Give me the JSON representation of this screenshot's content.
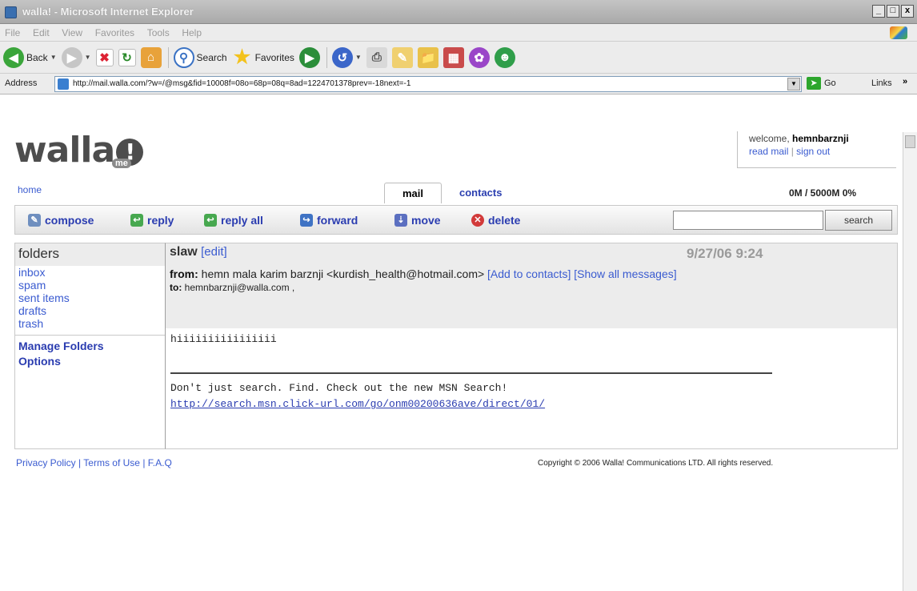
{
  "window": {
    "title": "walla! - Microsoft Internet Explorer",
    "min": "_",
    "max": "□",
    "close": "x"
  },
  "menu": [
    "File",
    "Edit",
    "View",
    "Favorites",
    "Tools",
    "Help"
  ],
  "toolbar": {
    "back": "Back",
    "search": "Search",
    "favorites": "Favorites"
  },
  "address": {
    "label": "Address",
    "url": "http://mail.walla.com/?w=/@msg&fid=10008f=08o=68p=08q=8ad=1224701378prev=-18next=-1",
    "go": "Go",
    "links": "Links",
    "more": "»"
  },
  "brand": {
    "logo": "walla",
    "logo_mark": "!",
    "logo_sub": "me"
  },
  "user": {
    "welcome": "welcome,",
    "username": "hemnbarznji",
    "read_mail": "read mail",
    "divider": "|",
    "sign_out": "sign out"
  },
  "nav": {
    "home": "home",
    "tabs": [
      {
        "label": "mail",
        "active": true
      },
      {
        "label": "contacts",
        "active": false
      }
    ],
    "quota": "0M / 5000M 0%"
  },
  "actions": {
    "compose": "compose",
    "reply": "reply",
    "reply_all": "reply all",
    "forward": "forward",
    "move": "move",
    "delete": "delete",
    "search_button": "search",
    "search_value": ""
  },
  "folders": {
    "header": "folders",
    "items": [
      "inbox",
      "spam",
      "sent items",
      "drafts",
      "trash"
    ],
    "manage": "Manage Folders",
    "options": "Options"
  },
  "message": {
    "subject": "slaw",
    "edit": "[edit]",
    "date": "9/27/06 9:24",
    "from_label": "from:",
    "from_value": "hemn mala karim barznji <kurdish_health@hotmail.com>",
    "add_contacts": "[Add to contacts]",
    "show_all": "[Show all messages]",
    "to_label": "to:",
    "to_value": "hemnbarznji@walla.com ,",
    "body": "hiiiiiiiiiiiiiiii",
    "signature": "Don't just search. Find. Check out the new MSN Search!",
    "signature_url": "http://search.msn.click-url.com/go/onm00200636ave/direct/01/"
  },
  "footer": {
    "privacy": "Privacy Policy",
    "terms": "Terms of Use",
    "faq": "F.A.Q",
    "divider": "|",
    "copyright": "Copyright © 2006 Walla! Communications LTD. All rights reserved."
  }
}
